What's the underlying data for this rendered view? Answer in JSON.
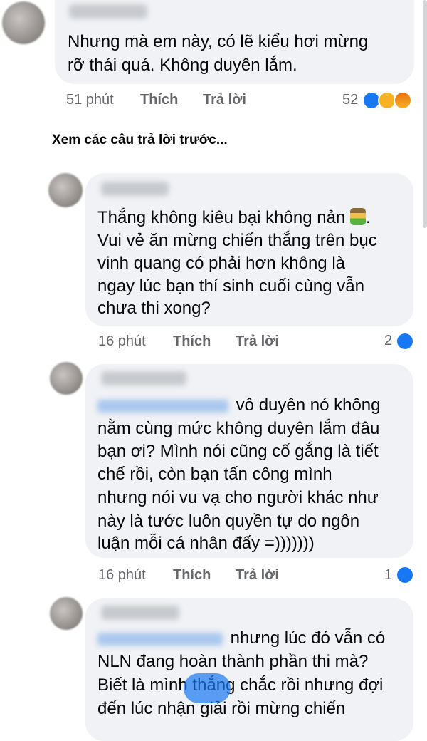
{
  "comments": [
    {
      "text_lines": [
        "Nhưng mà em này, có lẽ kiểu hơi mừng",
        "rỡ thái quá. Không duyên lắm."
      ],
      "time": "51 phút",
      "like_label": "Thích",
      "reply_label": "Trả lời",
      "reaction_count": "52",
      "reactions": [
        "like-icon",
        "haha-icon",
        "angry-icon"
      ]
    },
    {
      "text_lines": [
        "Thắng không kiêu bại không nản",
        "Vui vẻ ăn mừng chiến thắng trên bục",
        "vinh quang có phải hơn không là",
        "ngay lúc bạn thí sinh cuối cùng vẫn",
        "chưa thi xong?"
      ],
      "emoji": "person-gesturing-emoji",
      "time": "16 phút",
      "like_label": "Thích",
      "reply_label": "Trả lời",
      "reaction_count": "2",
      "reactions": [
        "like-icon"
      ]
    },
    {
      "text_lines": [
        "vô duyên nó không",
        "nằm cùng mức không duyên lắm đâu",
        "bạn ơi? Mình nói cũng cố gắng là tiết",
        "chế rồi, còn bạn tấn công mình",
        "nhưng nói vu vạ cho người khác như",
        "này là tước luôn quyền tự do ngôn",
        "luận mỗi cá nhân đấy =)))))))"
      ],
      "time": "16 phút",
      "like_label": "Thích",
      "reply_label": "Trả lời",
      "reaction_count": "1",
      "reactions": [
        "like-icon"
      ]
    },
    {
      "text_lines": [
        "nhưng lúc đó vẫn có",
        "NLN đang hoàn thành phần thi mà?",
        "Biết là mình thắng chắc rồi nhưng đợi",
        "đến lúc nhận giải rồi mừng chiến"
      ]
    }
  ],
  "see_previous_replies": "Xem các câu trả lời trước...",
  "colors": {
    "bubble": "#f0f2f5",
    "meta_text": "#65676b",
    "like_blue": "#1877f2",
    "mention_blue": "#a9c7ee"
  }
}
